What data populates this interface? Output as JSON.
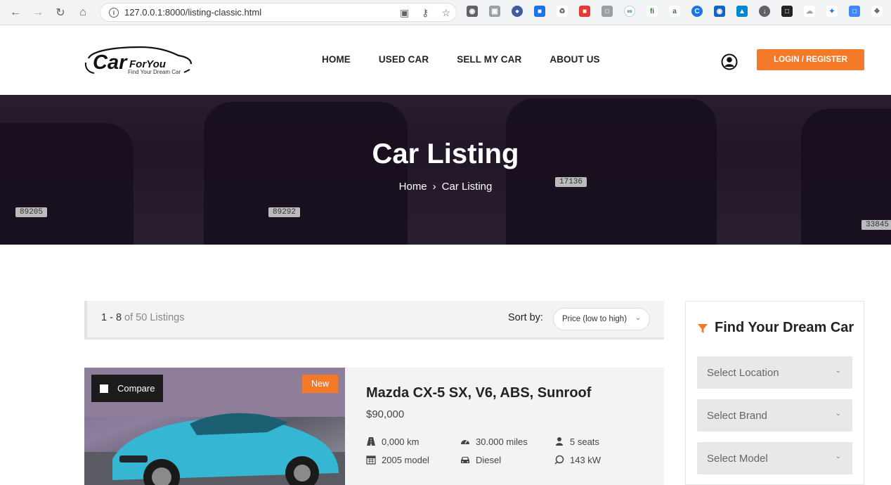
{
  "browser": {
    "url": "127.0.0.1:8000/listing-classic.html"
  },
  "header": {
    "logo": {
      "car": "Car",
      "for_you": "ForYou",
      "tagline": "Find Your Dream Car"
    },
    "nav": [
      "HOME",
      "USED CAR",
      "SELL MY CAR",
      "ABOUT US"
    ],
    "login_label": "LOGIN / REGISTER",
    "accent_color": "#f47a2a"
  },
  "hero": {
    "title": "Car Listing",
    "crumb_home": "Home",
    "crumb_current": "Car Listing",
    "plates": [
      "89205",
      "89292",
      "17136",
      "33845"
    ]
  },
  "results": {
    "range": "1 - 8",
    "total": "of 50 Listings",
    "sort_label": "Sort by:",
    "sort_value": "Price (low to high)"
  },
  "listing": {
    "compare_label": "Compare",
    "badge": "New",
    "title": "Mazda CX-5 SX, V6, ABS, Sunroof",
    "price": "$90,000",
    "specs": [
      {
        "icon": "road-icon",
        "text": "0,000 km"
      },
      {
        "icon": "tachometer-icon",
        "text": "30.000 miles"
      },
      {
        "icon": "user-icon",
        "text": "5 seats"
      },
      {
        "icon": "calendar-icon",
        "text": "2005 model"
      },
      {
        "icon": "car-icon",
        "text": "Diesel"
      },
      {
        "icon": "power-icon",
        "text": "143 kW"
      }
    ]
  },
  "sidebar": {
    "title": "Find Your Dream Car",
    "selects": [
      "Select Location",
      "Select Brand",
      "Select Model"
    ]
  }
}
